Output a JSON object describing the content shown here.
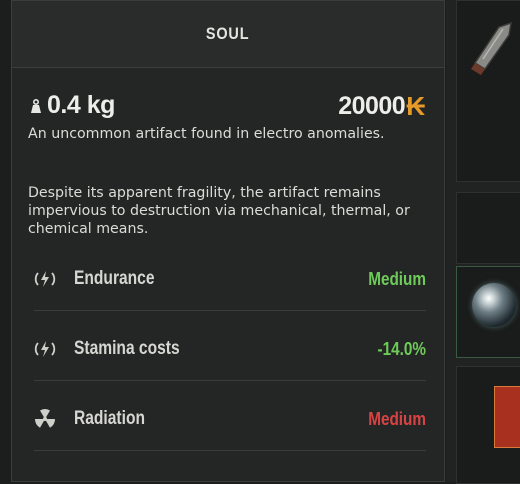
{
  "tooltip": {
    "title": "SOUL",
    "weight": "0.4 kg",
    "price": "20000",
    "currency_symbol": "₭",
    "description_1": "An uncommon artifact found in electro anomalies.",
    "description_2": "Despite its apparent fragility, the artifact remains impervious to destruction via mechanical, thermal, or chemical means.",
    "stats": [
      {
        "label": "Endurance",
        "value": "Medium",
        "icon": "electro-icon",
        "value_color": "#6ecb59"
      },
      {
        "label": "Stamina costs",
        "value": "-14.0%",
        "icon": "electro-icon",
        "value_color": "#6ecb59"
      },
      {
        "label": "Radiation",
        "value": "Medium",
        "icon": "radiation-icon",
        "value_color": "#d84444"
      }
    ]
  },
  "colors": {
    "accent_currency": "#e69a2a",
    "positive": "#6ecb59",
    "negative": "#d84444"
  }
}
